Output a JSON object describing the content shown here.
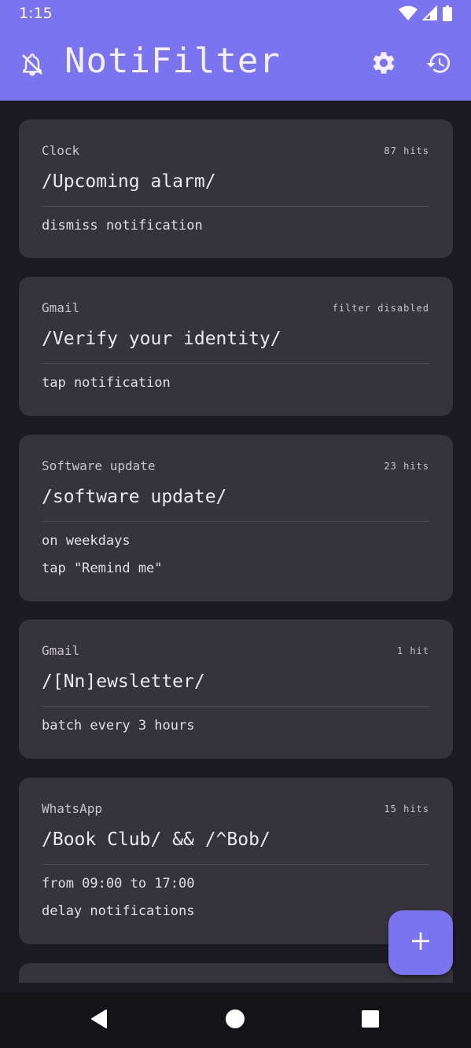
{
  "status_bar": {
    "time": "1:15",
    "icons": [
      "wifi-icon",
      "cell-signal-icon",
      "battery-icon"
    ]
  },
  "app_bar": {
    "title": "NotiFilter",
    "left_icon": "notifications-off-icon",
    "actions": [
      "settings-icon",
      "history-icon"
    ],
    "color": "#7a74f0"
  },
  "filters": [
    {
      "app": "Clock",
      "hits": "87 hits",
      "pattern": "/Upcoming alarm/",
      "actions": [
        "dismiss notification"
      ]
    },
    {
      "app": "Gmail",
      "hits": "filter disabled",
      "pattern": "/Verify your identity/",
      "actions": [
        "tap notification"
      ]
    },
    {
      "app": "Software update",
      "hits": "23 hits",
      "pattern": "/software update/",
      "actions": [
        "on weekdays",
        "tap \"Remind me\""
      ]
    },
    {
      "app": "Gmail",
      "hits": "1 hit",
      "pattern": "/[Nn]ewsletter/",
      "actions": [
        "batch every 3 hours"
      ]
    },
    {
      "app": "WhatsApp",
      "hits": "15 hits",
      "pattern": "/Book Club/ && /^Bob/",
      "actions": [
        "from 09:00 to 17:00",
        "delay notifications"
      ]
    }
  ],
  "fab": {
    "icon": "add-icon"
  },
  "nav_bar": {
    "buttons": [
      "back-icon",
      "home-icon",
      "recents-icon"
    ]
  }
}
